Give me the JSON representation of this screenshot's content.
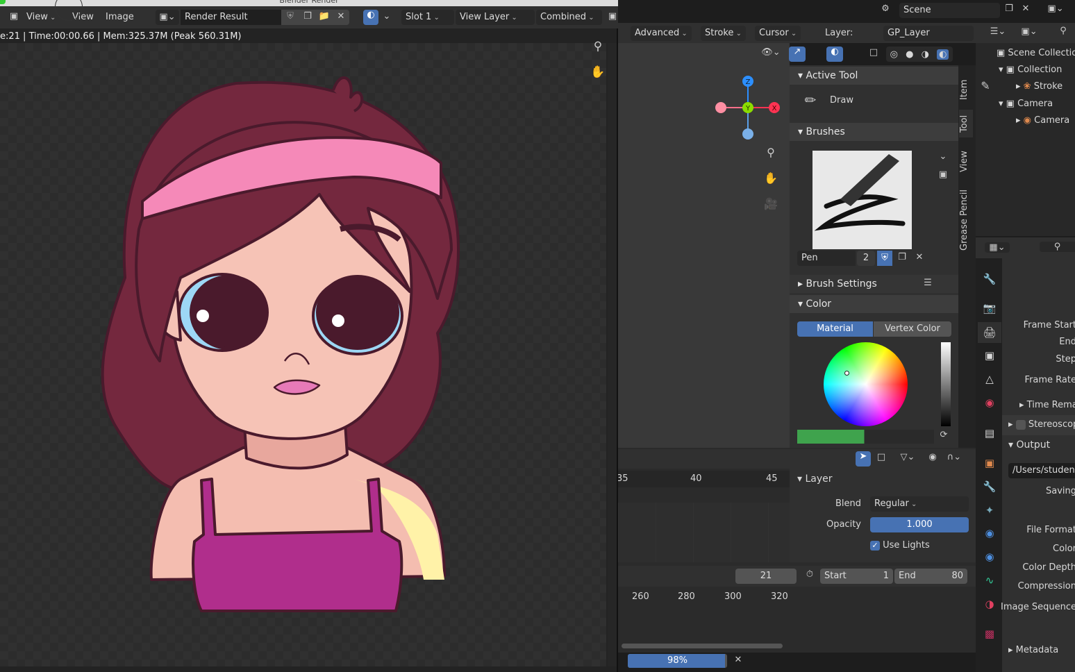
{
  "render_window": {
    "title": "Blender Render",
    "menu": [
      "View",
      "View",
      "Image"
    ],
    "image_name": "Render Result",
    "slot": "Slot 1",
    "view_layer": "View Layer",
    "pass": "Combined",
    "info": "e:21 | Time:00:00.66 | Mem:325.37M (Peak 560.31M)"
  },
  "topbar": {
    "scene": "Scene"
  },
  "viewport_header": {
    "mode_items": [
      "Advanced",
      "Stroke",
      "Cursor"
    ],
    "layer_label": "Layer:",
    "layer_value": "GP_Layer"
  },
  "gizmo": {
    "z": "Z",
    "y": "Y",
    "x": "X"
  },
  "sidebar": {
    "tabs": [
      "Item",
      "Tool",
      "View",
      "Grease Pencil"
    ],
    "active_tool": {
      "title": "Active Tool",
      "tool": "Draw"
    },
    "brushes": {
      "title": "Brushes",
      "brush": "Pen",
      "users": "2"
    },
    "brush_settings": "Brush Settings",
    "color": {
      "title": "Color",
      "modes": [
        "Material",
        "Vertex Color"
      ],
      "active_mode": "Material"
    }
  },
  "outliner": {
    "items": [
      "Scene Collection",
      "Collection",
      "Stroke",
      "Camera",
      "Camera"
    ]
  },
  "properties": {
    "labels": [
      "Frame Start",
      "End",
      "Step",
      "Frame Rate"
    ],
    "time_remap": "Time Remapping",
    "stereo": "Stereoscopy",
    "output": "Output",
    "path": "/Users/student",
    "saving": "Saving",
    "labels2": [
      "File Format",
      "Color",
      "Color Depth",
      "Compression",
      "Image Sequence"
    ],
    "metadata": "Metadata"
  },
  "layer_panel": {
    "title": "Layer",
    "blend_label": "Blend",
    "blend_value": "Regular",
    "opacity_label": "Opacity",
    "opacity_value": "1.000",
    "use_lights": "Use Lights",
    "use_lights_checked": true
  },
  "timeline": {
    "ticks_top": [
      "35",
      "40",
      "45"
    ],
    "current_frame": "21",
    "start_label": "Start",
    "start": "1",
    "end_label": "End",
    "end": "80",
    "ticks_bottom": [
      "260",
      "280",
      "300",
      "320"
    ],
    "progress": "98%",
    "progress_value": 0.98
  }
}
